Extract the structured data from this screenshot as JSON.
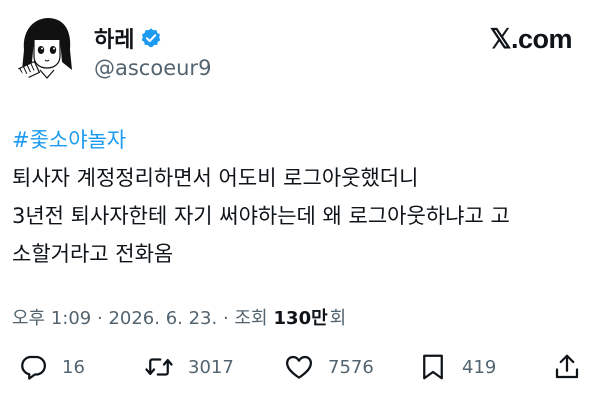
{
  "author": {
    "display_name": "하레",
    "handle": "@ascoeur9",
    "verified": true,
    "verified_color": "#1d9bf0"
  },
  "brand": {
    "logo_text": "𝕏.com"
  },
  "tweet": {
    "hashtag": "#좇소야놀자",
    "lines": [
      "퇴사자 계정정리하면서 어도비 로그아웃했더니",
      "3년전 퇴사자한테 자기 써야하는데 왜 로그아웃하냐고 고",
      "소할거라고 전화옴"
    ]
  },
  "meta": {
    "time": "오후 1:09",
    "separator": " · ",
    "date": "2026. 6. 23.",
    "separator2": " · ",
    "views_label": "조회",
    "views_value": "130만",
    "views_unit": "회"
  },
  "actions": {
    "replies": "16",
    "retweets": "3017",
    "likes": "7576",
    "bookmarks": "419"
  },
  "icons": {
    "reply": "reply-icon",
    "retweet": "retweet-icon",
    "like": "heart-icon",
    "bookmark": "bookmark-icon",
    "share": "share-icon"
  },
  "colors": {
    "text": "#0f1419",
    "secondary": "#536471",
    "hashtag": "#1d9bf0"
  }
}
